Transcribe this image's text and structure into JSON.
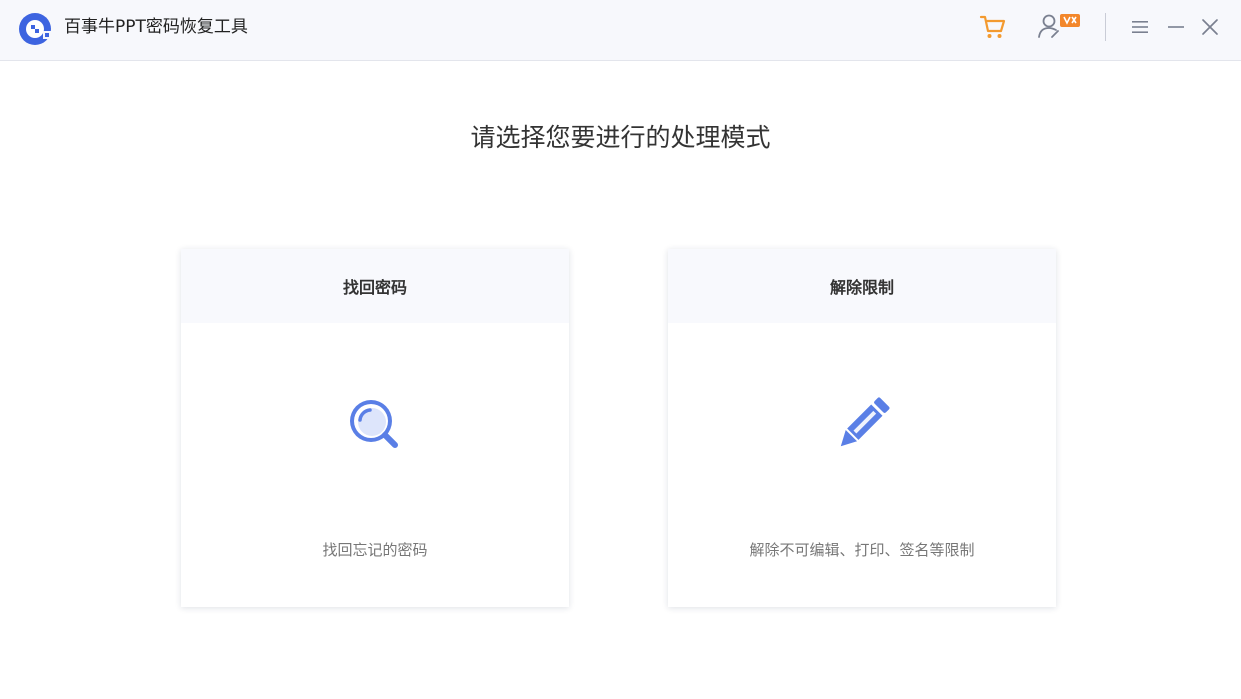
{
  "app": {
    "title": "百事牛PPT密码恢复工具",
    "logo_icon": "baishiniu-logo",
    "brand_color": "#3d64e0",
    "accent_color": "#f39a2f"
  },
  "titlebar": {
    "cart_icon": "shopping-cart-icon",
    "user_icon": "user-account-icon",
    "menu_icon": "hamburger-menu-icon",
    "minimize_icon": "minimize-icon",
    "close_icon": "close-icon"
  },
  "main": {
    "heading": "请选择您要进行的处理模式",
    "modes": [
      {
        "title": "找回密码",
        "description": "找回忘记的密码",
        "icon": "magnifier-icon"
      },
      {
        "title": "解除限制",
        "description": "解除不可编辑、打印、签名等限制",
        "icon": "pencil-icon"
      }
    ],
    "icon_color": "#5a7fe6"
  }
}
